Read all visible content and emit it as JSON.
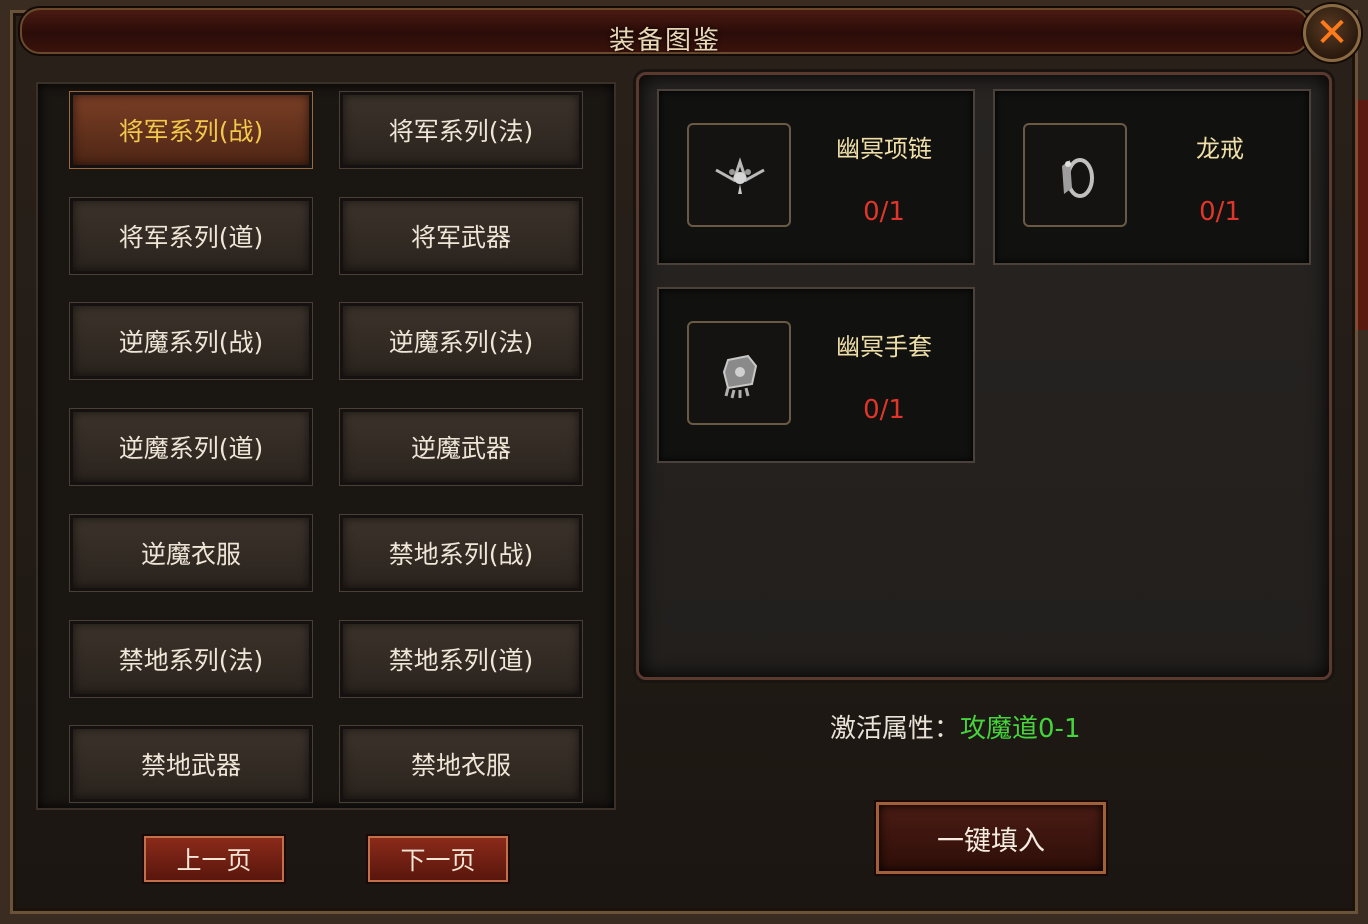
{
  "window": {
    "title": "装备图鉴",
    "close_glyph": "✕"
  },
  "series_buttons": [
    {
      "label": "将军系列(战)",
      "active": true
    },
    {
      "label": "将军系列(法)",
      "active": false
    },
    {
      "label": "将军系列(道)",
      "active": false
    },
    {
      "label": "将军武器",
      "active": false
    },
    {
      "label": "逆魔系列(战)",
      "active": false
    },
    {
      "label": "逆魔系列(法)",
      "active": false
    },
    {
      "label": "逆魔系列(道)",
      "active": false
    },
    {
      "label": "逆魔武器",
      "active": false
    },
    {
      "label": "逆魔衣服",
      "active": false
    },
    {
      "label": "禁地系列(战)",
      "active": false
    },
    {
      "label": "禁地系列(法)",
      "active": false
    },
    {
      "label": "禁地系列(道)",
      "active": false
    },
    {
      "label": "禁地武器",
      "active": false
    },
    {
      "label": "禁地衣服",
      "active": false
    }
  ],
  "pagination": {
    "prev_label": "上一页",
    "next_label": "下一页"
  },
  "items": [
    {
      "name": "幽冥项链",
      "count": "0/1",
      "icon": "necklace-icon"
    },
    {
      "name": "龙戒",
      "count": "0/1",
      "icon": "ring-icon"
    },
    {
      "name": "幽冥手套",
      "count": "0/1",
      "icon": "glove-icon"
    }
  ],
  "activation": {
    "label": "激活属性：",
    "value": "攻魔道0-1"
  },
  "fill_button": {
    "label": "一键填入"
  },
  "colors": {
    "active_text": "#f2c94c",
    "count_text": "#e0362a",
    "attr_value": "#45d43c",
    "item_name": "#f0dfa8"
  }
}
